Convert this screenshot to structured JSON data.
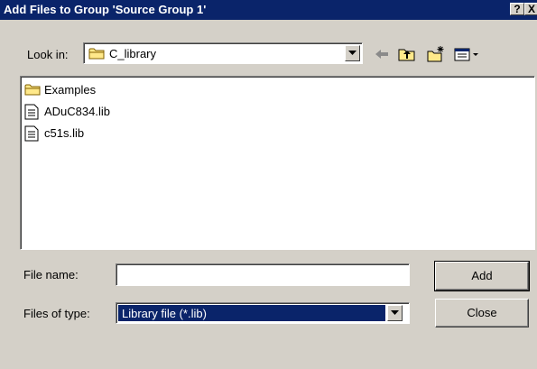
{
  "window": {
    "title": "Add Files to Group 'Source Group 1'",
    "help_glyph": "?",
    "close_glyph": "X"
  },
  "look_in": {
    "label": "Look in:",
    "value": "C_library"
  },
  "toolbar": {
    "icons": [
      "back-arrow-icon",
      "up-folder-icon",
      "new-folder-icon",
      "view-menu-icon"
    ]
  },
  "files": [
    {
      "name": "Examples",
      "icon": "folder-icon"
    },
    {
      "name": "ADuC834.lib",
      "icon": "file-icon"
    },
    {
      "name": "c51s.lib",
      "icon": "file-icon"
    }
  ],
  "file_name": {
    "label": "File name:",
    "value": ""
  },
  "file_type": {
    "label": "Files of type:",
    "value": "Library file (*.lib)"
  },
  "buttons": {
    "add": "Add",
    "close": "Close"
  },
  "colors": {
    "titlebar": "#0a246a",
    "dialog": "#d4d0c8",
    "selection": "#0a246a"
  }
}
